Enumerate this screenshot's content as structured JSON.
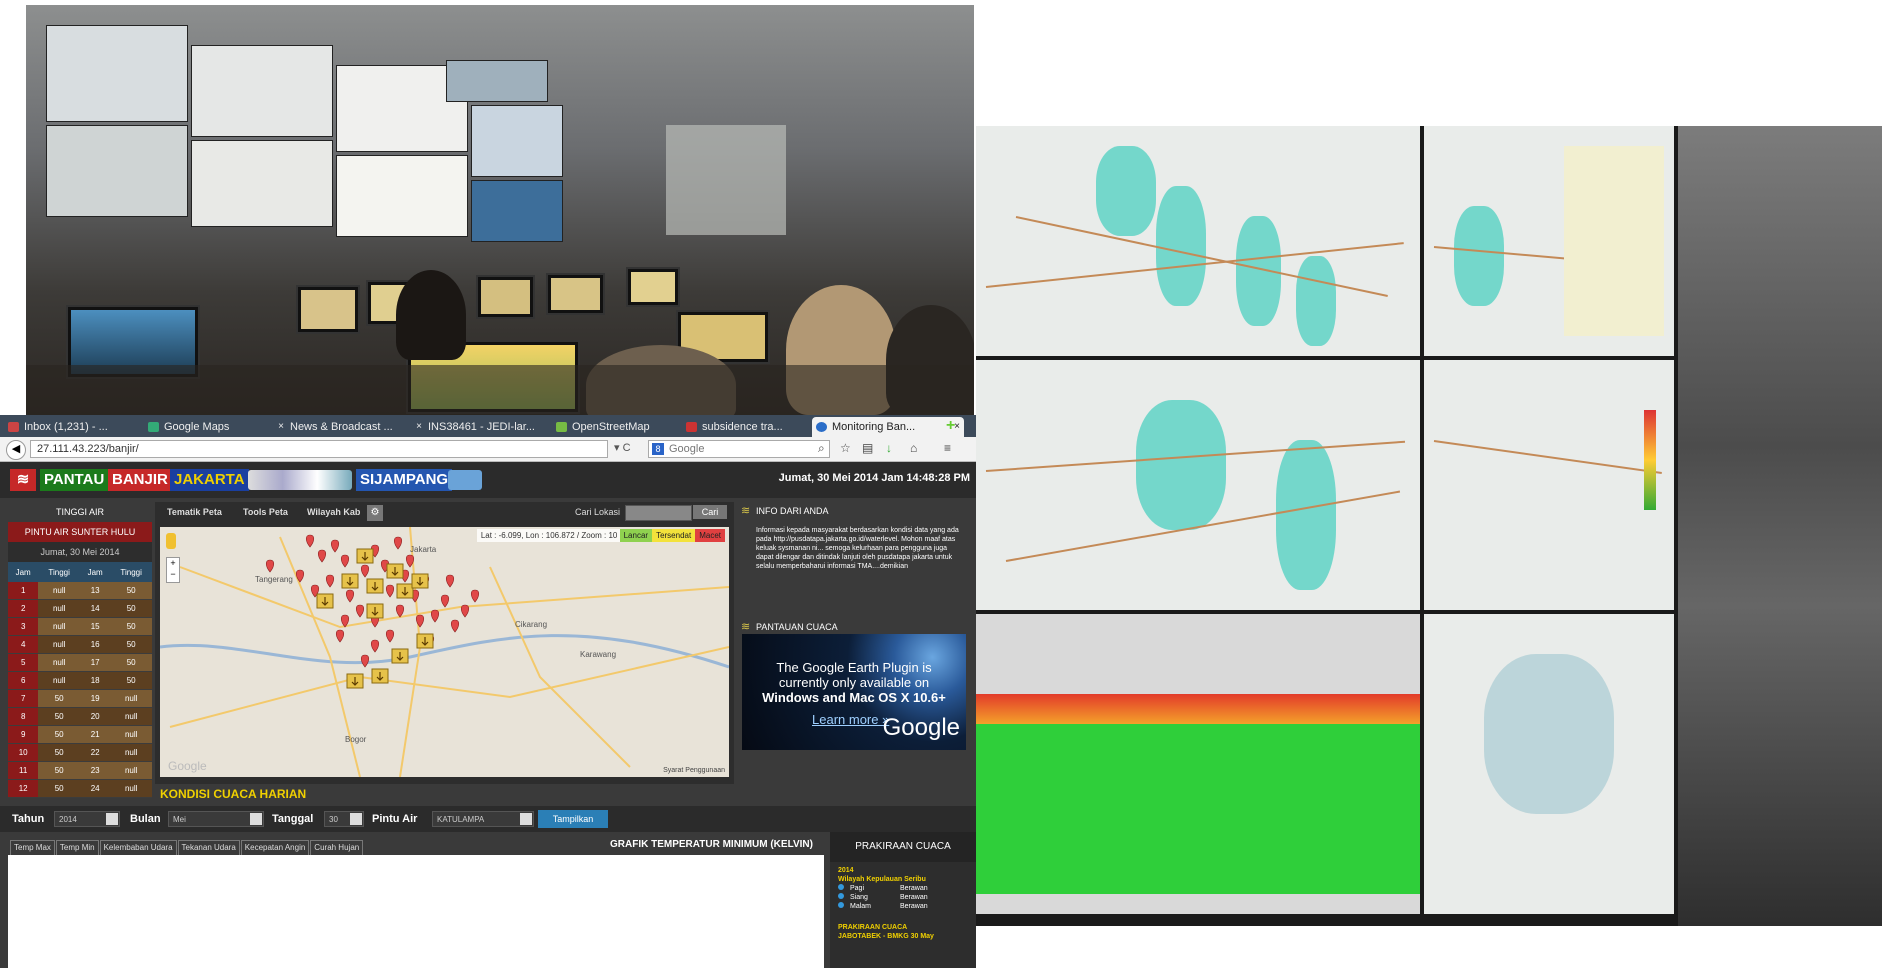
{
  "browser": {
    "tabs": [
      {
        "label": "Inbox (1,231) - ..."
      },
      {
        "label": "Google Maps"
      },
      {
        "label": "News & Broadcast ..."
      },
      {
        "label": "INS38461 - JEDI-lar..."
      },
      {
        "label": "OpenStreetMap"
      },
      {
        "label": "subsidence tra..."
      },
      {
        "label": "Monitoring Ban..."
      }
    ],
    "url": "27.111.43.223/banjir/",
    "search_placeholder": "Google"
  },
  "site": {
    "logo": {
      "pantau": "PANTAU",
      "banjir": "BANJIR",
      "jakarta": "JAKARTA",
      "sijampang": "SIJAMPANG"
    },
    "timestamp": "Jumat, 30 Mei 2014 Jam 14:48:28 PM",
    "left": {
      "title": "TINGGI AIR",
      "location": "PINTU AIR SUNTER HULU",
      "date": "Jumat, 30 Mei 2014",
      "headers": [
        "Jam",
        "Tinggi",
        "Jam",
        "Tinggi"
      ],
      "rows": [
        [
          "1",
          "null",
          "13",
          "50"
        ],
        [
          "2",
          "null",
          "14",
          "50"
        ],
        [
          "3",
          "null",
          "15",
          "50"
        ],
        [
          "4",
          "null",
          "16",
          "50"
        ],
        [
          "5",
          "null",
          "17",
          "50"
        ],
        [
          "6",
          "null",
          "18",
          "50"
        ],
        [
          "7",
          "50",
          "19",
          "null"
        ],
        [
          "8",
          "50",
          "20",
          "null"
        ],
        [
          "9",
          "50",
          "21",
          "null"
        ],
        [
          "10",
          "50",
          "22",
          "null"
        ],
        [
          "11",
          "50",
          "23",
          "null"
        ],
        [
          "12",
          "50",
          "24",
          "null"
        ]
      ]
    },
    "map": {
      "menu": [
        "Tematik Peta",
        "Tools Peta",
        "Wilayah Kab"
      ],
      "search_label": "Cari Lokasi",
      "search_button": "Cari",
      "coords": "Lat : -6.099, Lon : 106.872 / Zoom : 10",
      "legend": [
        {
          "label": "Lancar",
          "color": "#8fd14f"
        },
        {
          "label": "Tersendat",
          "color": "#f3e23b"
        },
        {
          "label": "Macet",
          "color": "#e04040"
        }
      ],
      "places": [
        "Tangerang",
        "Jakarta",
        "Cikarang",
        "Karawang",
        "Bogor"
      ],
      "footer": "Syarat Penggunaan",
      "watermark": "Google"
    },
    "info": {
      "title": "INFO DARI ANDA",
      "text": "Informasi kepada masyarakat berdasarkan kondisi data yang ada pada http://pusdatapa.jakarta.go.id/waterlevel. Mohon maaf atas keluak sysmanan ni... semoga kelurhaan para pengguna juga dapat dilengar dan ditindak lanjuti oleh pusdatapa jakarta untuk selalu memperbaharui informasi TMA....demikian"
    },
    "cuaca": {
      "title": "PANTAUAN CUACA",
      "plugin_line1": "The Google Earth Plugin is",
      "plugin_line2": "currently only available on",
      "plugin_line3": "Windows and Mac OS X 10.6+",
      "learn_more": "Learn more »",
      "google": "Google"
    },
    "kondisi": "KONDISI CUACA HARIAN",
    "filters": {
      "tahun_label": "Tahun",
      "tahun_value": "2014",
      "bulan_label": "Bulan",
      "bulan_value": "Mei",
      "tanggal_label": "Tanggal",
      "tanggal_value": "30",
      "pintu_label": "Pintu Air",
      "pintu_value": "KATULAMPA",
      "button": "Tampilkan"
    },
    "tabs2": [
      "Temp Max",
      "Temp Min",
      "Kelembaban Udara",
      "Tekanan Udara",
      "Kecepatan Angin",
      "Curah Hujan"
    ],
    "grafik_title": "GRAFIK TEMPERATUR MINIMUM (KELVIN)",
    "prakiraan": {
      "title": "PRAKIRAAN CUACA",
      "year": "2014",
      "region": "Wilayah Kepulauan Seribu",
      "rows": [
        [
          "Pagi",
          "Berawan"
        ],
        [
          "Siang",
          "Berawan"
        ],
        [
          "Malam",
          "Berawan"
        ]
      ],
      "footer1": "PRAKIRAAN CUACA",
      "footer2": "JABOTABEK - BMKG 30 May"
    }
  }
}
